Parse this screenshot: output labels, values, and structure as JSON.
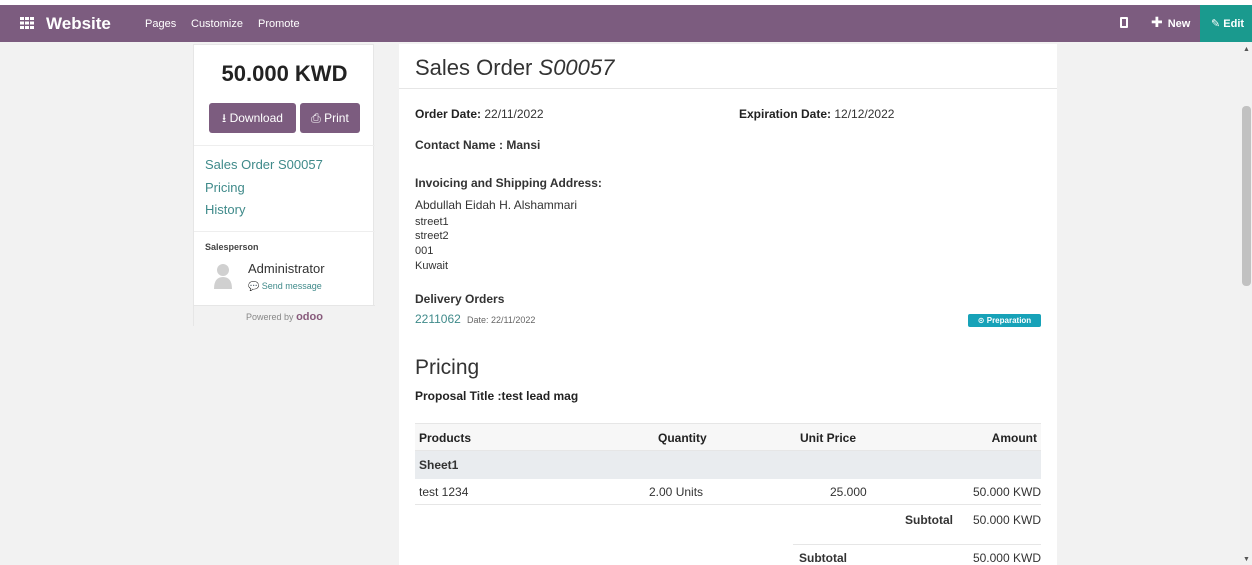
{
  "topbar": {
    "brand": "Website",
    "menu": [
      "Pages",
      "Customize",
      "Promote"
    ],
    "new_label": "New",
    "edit_label": "Edit"
  },
  "sidebar": {
    "amount": "50.000 KWD",
    "download_label": "Download",
    "print_label": "Print",
    "links": [
      "Sales Order S00057",
      "Pricing",
      "History"
    ],
    "salesperson_label": "Salesperson",
    "salesperson_name": "Administrator",
    "send_message": "Send message",
    "powered_by": "Powered by",
    "powered_brand": "odoo"
  },
  "document": {
    "title_prefix": "Sales Order",
    "title_number": "S00057",
    "order_date_label": "Order Date:",
    "order_date": "22/11/2022",
    "expiration_label": "Expiration Date:",
    "expiration_date": "12/12/2022",
    "contact_label": "Contact Name : Mansi",
    "address_label": "Invoicing and Shipping Address:",
    "address_name": "Abdullah Eidah H. Alshammari",
    "address_lines": [
      "street1",
      "street2",
      "001",
      "Kuwait"
    ],
    "delivery_label": "Delivery Orders",
    "delivery_number": "2211062",
    "delivery_date": "Date: 22/11/2022",
    "delivery_status": "Preparation",
    "pricing_heading": "Pricing",
    "proposal_title": "Proposal Title :test lead mag"
  },
  "table": {
    "headers": [
      "Products",
      "Quantity",
      "Unit Price",
      "Amount"
    ],
    "section": "Sheet1",
    "rows": [
      {
        "product": "test 1234",
        "quantity": "2.00 Units",
        "unit_price": "25.000",
        "amount": "50.000 KWD"
      }
    ],
    "section_subtotal_label": "Subtotal",
    "section_subtotal": "50.000 KWD",
    "total_subtotal_label": "Subtotal",
    "total_subtotal": "50.000 KWD"
  },
  "colors": {
    "topbar": "#7c5c7f",
    "edit_button": "#1a9a8e",
    "link": "#3f8a8a",
    "badge": "#17a2b8"
  }
}
